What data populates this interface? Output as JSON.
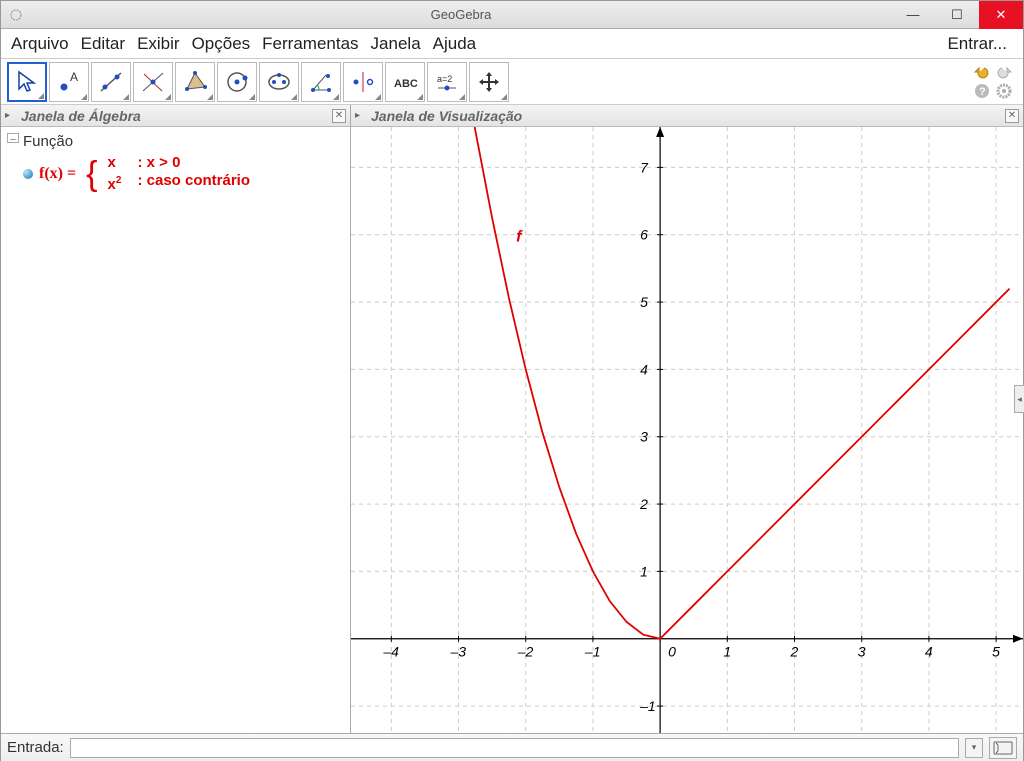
{
  "window": {
    "title": "GeoGebra"
  },
  "menu": {
    "arquivo": "Arquivo",
    "editar": "Editar",
    "exibir": "Exibir",
    "opcoes": "Opções",
    "ferramentas": "Ferramentas",
    "janela": "Janela",
    "ajuda": "Ajuda",
    "entrar": "Entrar..."
  },
  "panels": {
    "algebra_title": "Janela de Álgebra",
    "graph_title": "Janela de Visualização"
  },
  "algebra": {
    "category": "Função",
    "fn_name": "f(x)  =",
    "piece1_expr": "x",
    "piece1_cond": ": x > 0",
    "piece2_expr_base": "x",
    "piece2_expr_sup": "2",
    "piece2_cond": ": caso contrário"
  },
  "graph": {
    "fn_label": "f",
    "x_ticks": [
      "–4",
      "–3",
      "–2",
      "–1",
      "0",
      "1",
      "2",
      "3",
      "4",
      "5"
    ],
    "y_ticks": [
      "–1",
      "1",
      "2",
      "3",
      "4",
      "5",
      "6",
      "7"
    ]
  },
  "input": {
    "label": "Entrada:",
    "value": ""
  },
  "chart_data": {
    "type": "line",
    "title": "",
    "xlabel": "",
    "ylabel": "",
    "xlim": [
      -4.6,
      5.4
    ],
    "ylim": [
      -1.4,
      7.6
    ],
    "series": [
      {
        "name": "f",
        "color": "#e00000",
        "definition": "x if x>0 else x^2",
        "x": [
          -2.76,
          -2.5,
          -2.25,
          -2,
          -1.75,
          -1.5,
          -1.25,
          -1,
          -0.75,
          -0.5,
          -0.25,
          0,
          0.5,
          1,
          1.5,
          2,
          2.5,
          3,
          3.5,
          4,
          4.5,
          5,
          5.2
        ],
        "y": [
          7.6,
          6.25,
          5.06,
          4,
          3.06,
          2.25,
          1.56,
          1,
          0.56,
          0.25,
          0.06,
          0,
          0.5,
          1,
          1.5,
          2,
          2.5,
          3,
          3.5,
          4,
          4.5,
          5,
          5.2
        ]
      }
    ]
  }
}
